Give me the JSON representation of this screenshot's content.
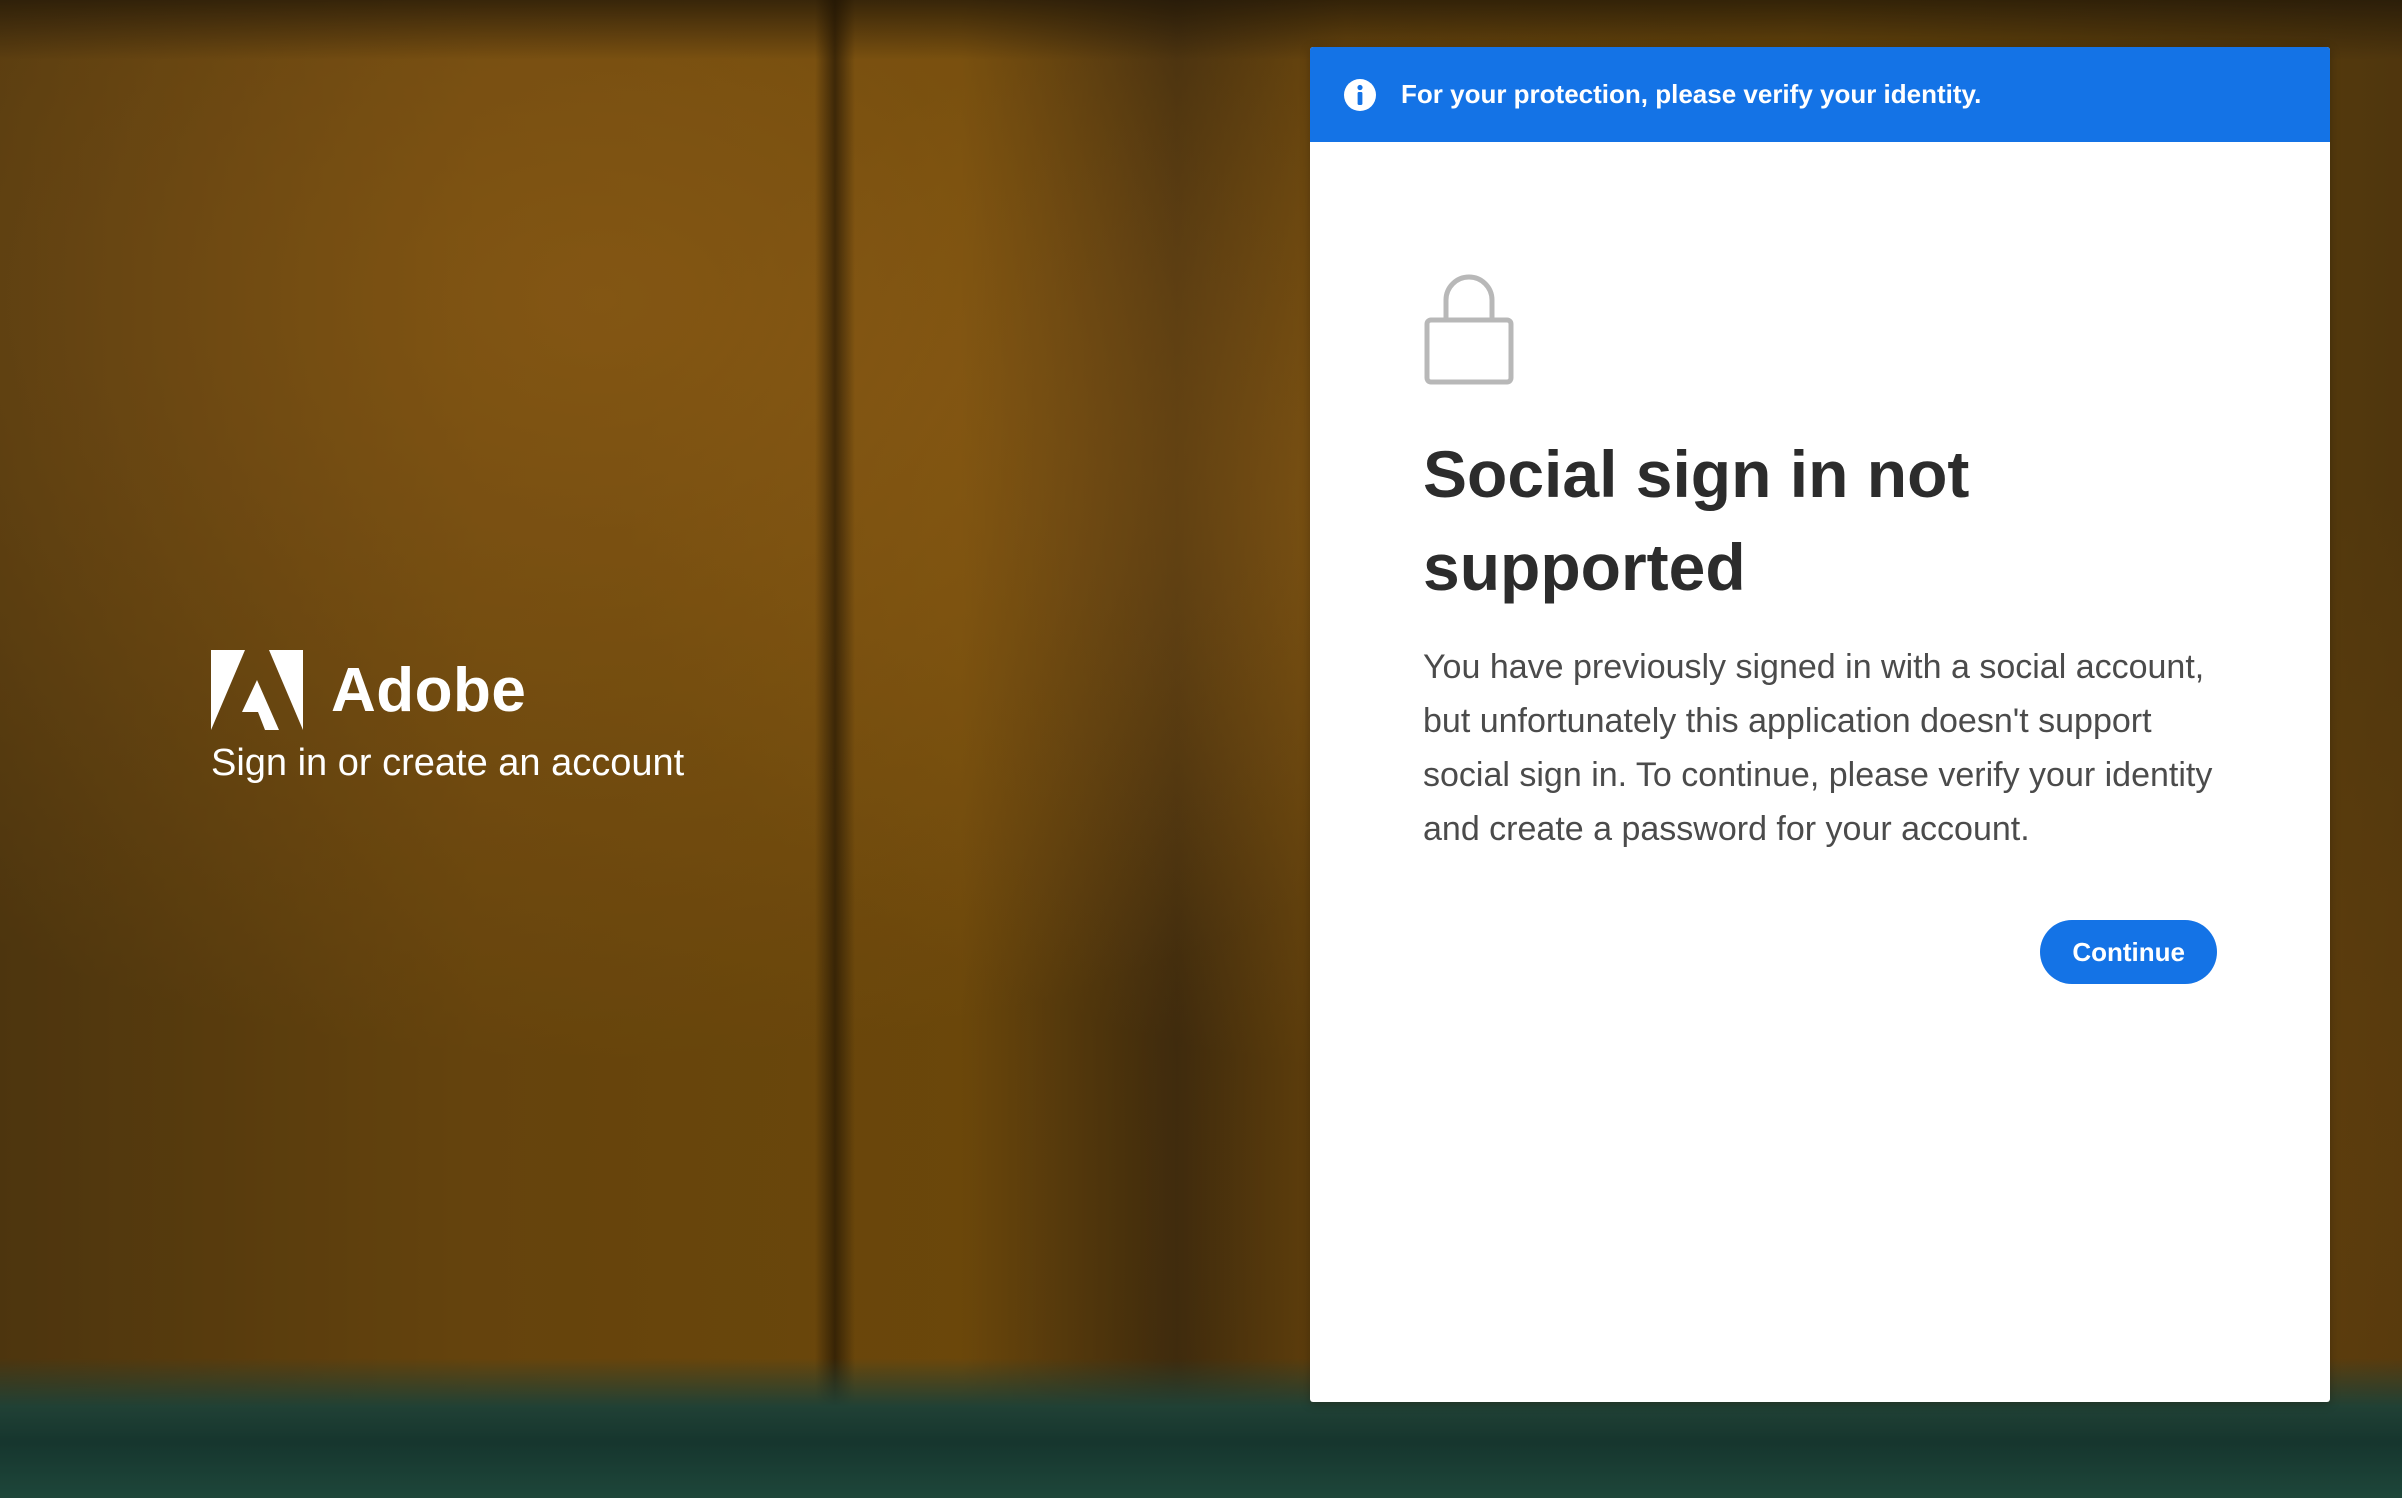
{
  "background": {
    "image": "honey-jars-photo"
  },
  "branding": {
    "logo_icon": "adobe-logo-icon",
    "name": "Adobe",
    "tagline": "Sign in or create an account"
  },
  "card": {
    "banner": {
      "icon": "info-icon",
      "text": "For your protection, please verify your identity.",
      "color": "#1473e6"
    },
    "lock_icon": "lock-icon",
    "title": "Social sign in not supported",
    "description": "You have previously signed in with a social account, but unfortunately this application doesn't support social sign in. To continue, please verify your identity and create a password for your account.",
    "continue_label": "Continue",
    "accent_color": "#1473e6"
  }
}
